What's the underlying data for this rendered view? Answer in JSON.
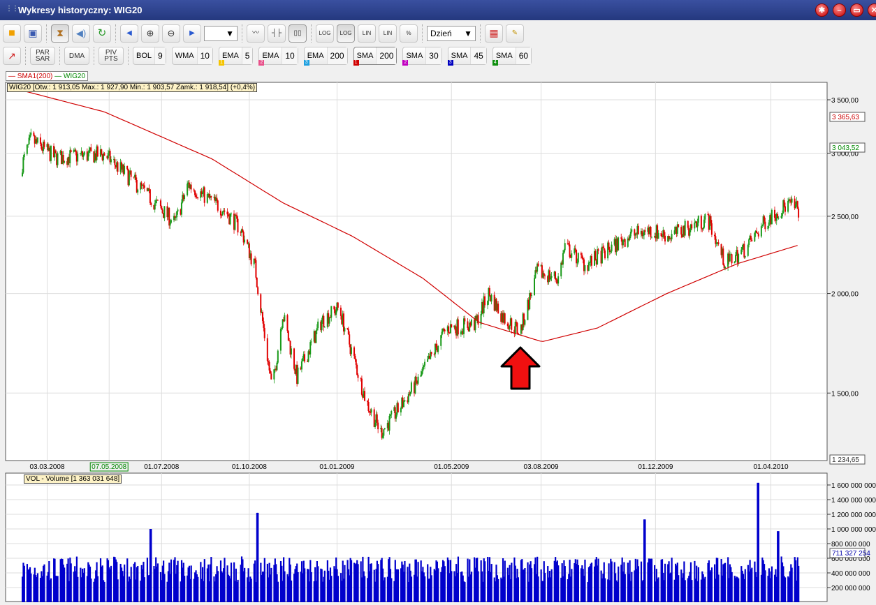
{
  "window": {
    "title": "Wykresy historyczny: WIG20",
    "controls": [
      "settings",
      "minimize",
      "restore",
      "close"
    ]
  },
  "toolbar1": {
    "period": "Dzień",
    "zoom_select": "",
    "buttons": [
      "open",
      "save",
      "hourglass",
      "sound",
      "refresh",
      "prev",
      "zoom-in",
      "zoom-out",
      "next",
      "line-chart",
      "ohlc-chart",
      "candle-chart"
    ],
    "scale_buttons": [
      {
        "top": "LOG",
        "bottom": "="
      },
      {
        "top": "LOG",
        "bottom": "≠"
      },
      {
        "top": "LIN",
        "bottom": "="
      },
      {
        "top": "LIN",
        "bottom": "≠"
      },
      {
        "top": "%",
        "bottom": "="
      }
    ]
  },
  "toolbar2": {
    "par_sar": [
      "PAR",
      "SAR"
    ],
    "dma": "DMA",
    "piv_pts": [
      "PIV",
      "PTS"
    ],
    "indicators": [
      {
        "label": "BOL",
        "value": "9"
      },
      {
        "label": "WMA",
        "value": "10"
      },
      {
        "label": "EMA",
        "value": "5",
        "tag": "1",
        "color": "#f5c400"
      },
      {
        "label": "EMA",
        "value": "10",
        "tag": "2",
        "color": "#e8508a"
      },
      {
        "label": "EMA",
        "value": "200",
        "tag": "3",
        "color": "#1ea0e0"
      },
      {
        "label": "SMA",
        "value": "200",
        "tag": "1",
        "color": "#d00000"
      },
      {
        "label": "SMA",
        "value": "30",
        "tag": "2",
        "color": "#c000c0"
      },
      {
        "label": "SMA",
        "value": "45",
        "tag": "3",
        "color": "#0000c0"
      },
      {
        "label": "SMA",
        "value": "60",
        "tag": "4",
        "color": "#109010"
      }
    ]
  },
  "legend": {
    "sma": "SMA1(200)",
    "wig": "WIG20"
  },
  "info": "WIG20 [Otw.: 1 913,05  Max.: 1 927,90  Min.: 1 903,57  Zamk.: 1 918,54] (+0,4%)",
  "volume_info": "VOL - Volume [1 363 031 648]",
  "chart_data": {
    "type": "candlestick",
    "scale": "log",
    "y_ticks": [
      3500,
      3000,
      2500,
      2000,
      1500
    ],
    "y_tick_labels": [
      "3 500,00",
      "3 000,00",
      "2 500,00",
      "2 000,00",
      "1 500,00"
    ],
    "markers": {
      "sma_last": "3 365,63",
      "wig_last": "3 043,52",
      "min": "1 234,65"
    },
    "x_labels": [
      {
        "date": "2008-03-03",
        "label": "03.03.2008"
      },
      {
        "date": "2008-05-07",
        "label": "07.05.2008",
        "highlight": true
      },
      {
        "date": "2008-07-01",
        "label": "01.07.2008"
      },
      {
        "date": "2008-10-01",
        "label": "01.10.2008"
      },
      {
        "date": "2009-01-01",
        "label": "01.01.2009"
      },
      {
        "date": "2009-05-01",
        "label": "01.05.2009"
      },
      {
        "date": "2009-08-03",
        "label": "03.08.2009"
      },
      {
        "date": "2009-12-01",
        "label": "01.12.2009"
      },
      {
        "date": "2010-04-01",
        "label": "01.04.2010"
      }
    ],
    "date_range": [
      "2008-02-06",
      "2010-04-30"
    ],
    "close_path": [
      [
        "2008-02-06",
        2909
      ],
      [
        "2008-02-15",
        3120
      ],
      [
        "2008-03-12",
        2960
      ],
      [
        "2008-05-02",
        2990
      ],
      [
        "2008-06-08",
        2720
      ],
      [
        "2008-07-15",
        2450
      ],
      [
        "2008-07-29",
        2740
      ],
      [
        "2008-09-04",
        2550
      ],
      [
        "2008-09-22",
        2410
      ],
      [
        "2008-10-07",
        2160
      ],
      [
        "2008-10-25",
        1510
      ],
      [
        "2008-11-05",
        1890
      ],
      [
        "2008-11-20",
        1570
      ],
      [
        "2008-12-16",
        1850
      ],
      [
        "2009-01-03",
        1920
      ],
      [
        "2009-02-01",
        1460
      ],
      [
        "2009-02-16",
        1340
      ],
      [
        "2009-02-27",
        1390
      ],
      [
        "2009-03-28",
        1560
      ],
      [
        "2009-04-26",
        1810
      ],
      [
        "2009-05-26",
        1830
      ],
      [
        "2009-06-09",
        2000
      ],
      [
        "2009-06-24",
        1870
      ],
      [
        "2009-07-12",
        1790
      ],
      [
        "2009-07-30",
        2130
      ],
      [
        "2009-08-21",
        2090
      ],
      [
        "2009-08-28",
        2290
      ],
      [
        "2009-09-19",
        2170
      ],
      [
        "2009-10-11",
        2260
      ],
      [
        "2009-11-02",
        2360
      ],
      [
        "2009-11-24",
        2400
      ],
      [
        "2009-12-16",
        2360
      ],
      [
        "2010-01-14",
        2450
      ],
      [
        "2010-01-25",
        2480
      ],
      [
        "2010-02-12",
        2180
      ],
      [
        "2010-03-06",
        2280
      ],
      [
        "2010-03-28",
        2480
      ],
      [
        "2010-04-19",
        2590
      ],
      [
        "2010-04-30",
        2550
      ]
    ],
    "sma200_path": [
      [
        "2008-02-06",
        3595
      ],
      [
        "2008-05-02",
        3380
      ],
      [
        "2008-08-23",
        2950
      ],
      [
        "2008-11-05",
        2600
      ],
      [
        "2009-01-17",
        2360
      ],
      [
        "2009-04-01",
        2090
      ],
      [
        "2009-05-30",
        1840
      ],
      [
        "2009-08-04",
        1740
      ],
      [
        "2009-10-01",
        1810
      ],
      [
        "2009-12-13",
        2000
      ],
      [
        "2010-02-25",
        2180
      ],
      [
        "2010-04-30",
        2300
      ]
    ],
    "volume": {
      "y_ticks": [
        200000000,
        400000000,
        600000000,
        800000000,
        1000000000,
        1200000000,
        1400000000,
        1600000000
      ],
      "y_tick_labels": [
        "200 000 000",
        "400 000 000",
        "600 000 000",
        "800 000 000",
        "1 000 000 000",
        "1 200 000 000",
        "1 400 000 000",
        "1 600 000 000"
      ],
      "last": "711 327 254",
      "typical": 500000000,
      "spikes": [
        [
          "2008-10-10",
          1220000000
        ],
        [
          "2009-11-20",
          1130000000
        ],
        [
          "2010-03-19",
          1630000000
        ],
        [
          "2010-04-09",
          970000000
        ],
        [
          "2008-06-20",
          1000000000
        ]
      ]
    }
  }
}
